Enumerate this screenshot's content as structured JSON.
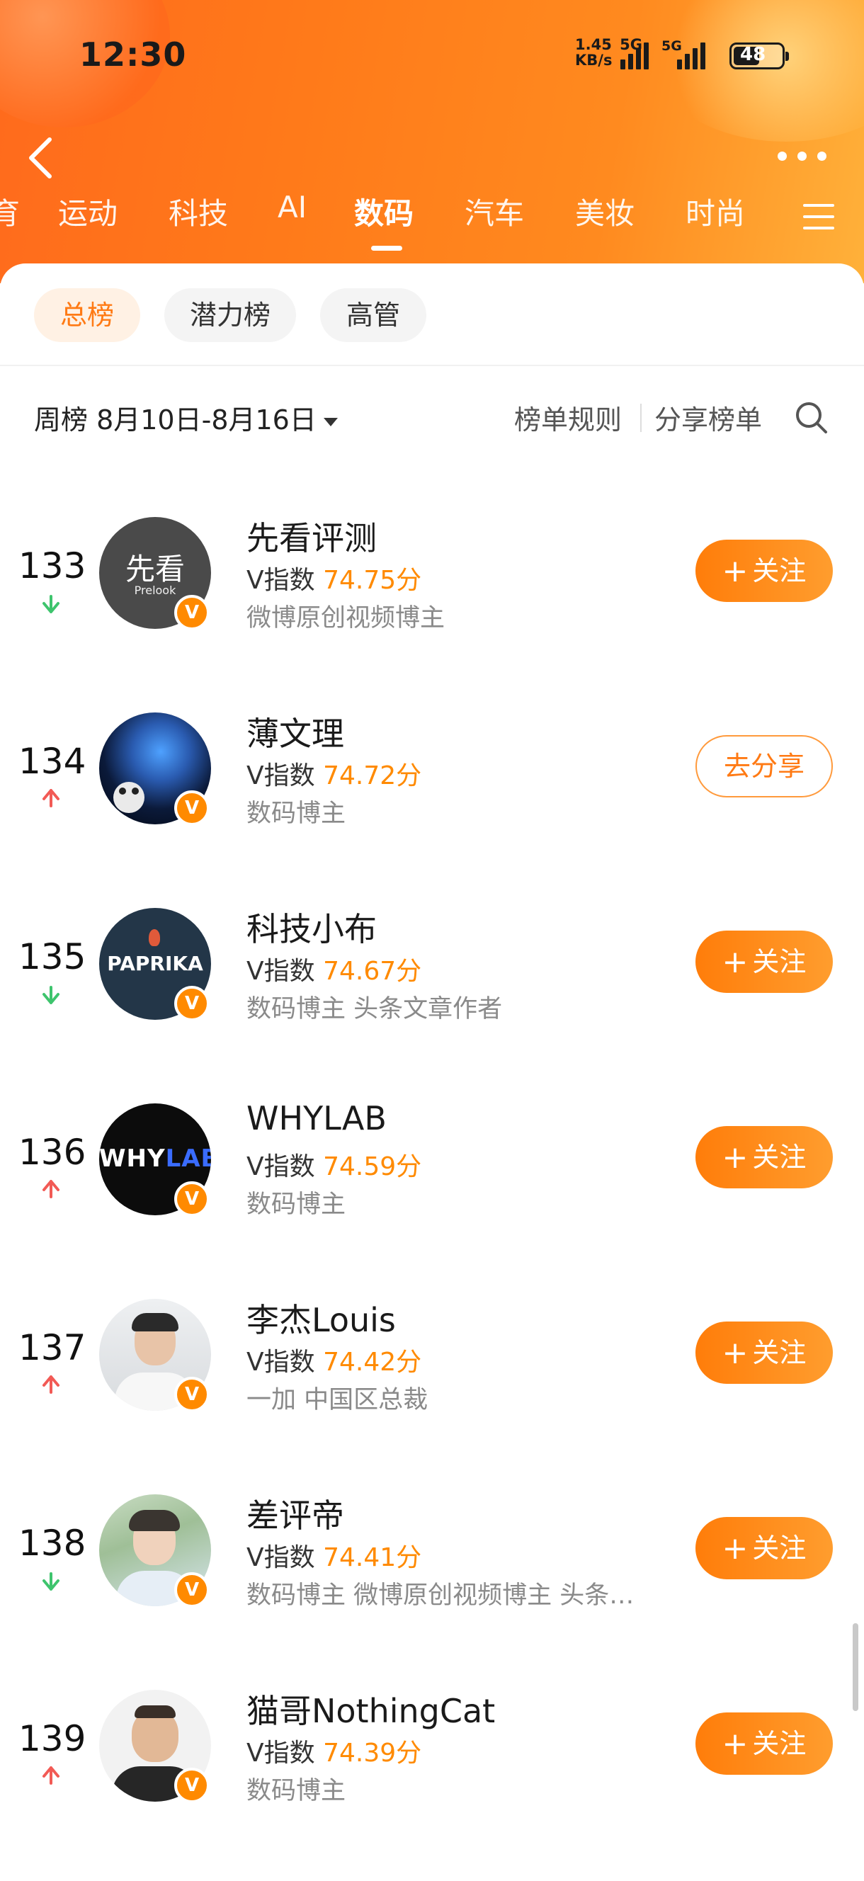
{
  "status_bar": {
    "time": "12:30",
    "net_speed": "1.45",
    "net_unit": "KB/s",
    "net_gen": "5G",
    "signal2_gen": "5G",
    "battery": "48"
  },
  "nav": {
    "tabs": [
      {
        "label": "育"
      },
      {
        "label": "运动"
      },
      {
        "label": "科技"
      },
      {
        "label": "AI"
      },
      {
        "label": "数码"
      },
      {
        "label": "汽车"
      },
      {
        "label": "美妆"
      },
      {
        "label": "时尚"
      }
    ],
    "active_tab": "数码"
  },
  "chips": [
    {
      "label": "总榜",
      "active": true
    },
    {
      "label": "潜力榜",
      "active": false
    },
    {
      "label": "高管",
      "active": false
    }
  ],
  "filter": {
    "period": "周榜 8月10日-8月16日",
    "rules": "榜单规则",
    "share": "分享榜单"
  },
  "rank_list": [
    {
      "rank": "133",
      "trend": "down",
      "name": "先看评测",
      "v_label": "V指数",
      "score": "74.75分",
      "desc": "微博原创视频博主",
      "button": "关注",
      "avatar_text": "先看",
      "avatar_sub": "Prelook"
    },
    {
      "rank": "134",
      "trend": "up",
      "name": "薄文理",
      "v_label": "V指数",
      "score": "74.72分",
      "desc": "数码博主",
      "button": "去分享"
    },
    {
      "rank": "135",
      "trend": "down",
      "name": "科技小布",
      "v_label": "V指数",
      "score": "74.67分",
      "desc": "数码博主 头条文章作者",
      "button": "关注",
      "avatar_text": "PAPRIKA"
    },
    {
      "rank": "136",
      "trend": "up",
      "name": "WHYLAB",
      "v_label": "V指数",
      "score": "74.59分",
      "desc": "数码博主",
      "button": "关注",
      "avatar_text": "WHY",
      "avatar_text2": "LAB"
    },
    {
      "rank": "137",
      "trend": "up",
      "name": "李杰Louis",
      "v_label": "V指数",
      "score": "74.42分",
      "desc": "一加 中国区总裁",
      "button": "关注"
    },
    {
      "rank": "138",
      "trend": "down",
      "name": "差评帝",
      "v_label": "V指数",
      "score": "74.41分",
      "desc": "数码博主 微博原创视频博主 头条…",
      "button": "关注"
    },
    {
      "rank": "139",
      "trend": "up",
      "name": "猫哥NothingCat",
      "v_label": "V指数",
      "score": "74.39分",
      "desc": "数码博主",
      "button": "关注"
    }
  ],
  "badge_letter": "V",
  "colors": {
    "accent": "#ff8a00",
    "up": "#f25a55",
    "down": "#3ec46d",
    "header": "#ff7a1a"
  }
}
